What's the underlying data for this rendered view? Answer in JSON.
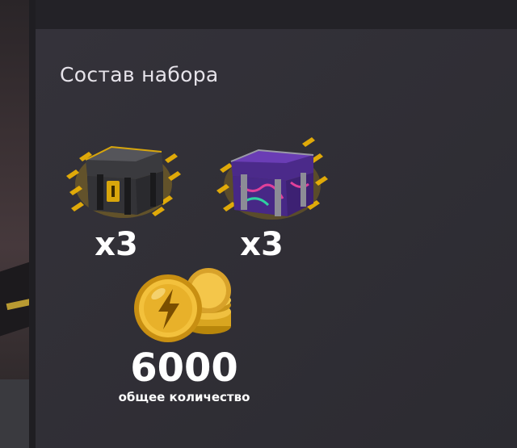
{
  "panel": {
    "title": "Состав набора"
  },
  "items": [
    {
      "name": "black-container",
      "quantity": "x3",
      "icon": "black-gold-container-icon"
    },
    {
      "name": "purple-container",
      "quantity": "x3",
      "icon": "purple-container-icon"
    }
  ],
  "currency": {
    "icon": "gold-coins-icon",
    "amount": "6000",
    "caption": "общее количество"
  },
  "colors": {
    "panel_bg": "#2d2b31",
    "gold_glow": "#f0b400",
    "text": "#ffffff"
  }
}
